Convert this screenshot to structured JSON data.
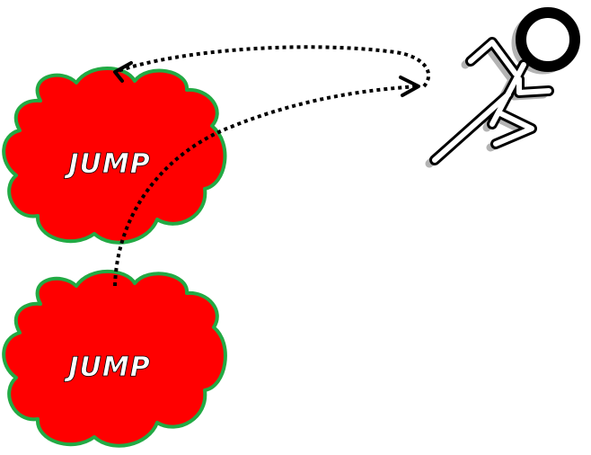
{
  "clouds": [
    {
      "id": "top",
      "label": "JUMP"
    },
    {
      "id": "bottom",
      "label": "JUMP"
    }
  ],
  "colors": {
    "cloud_fill": "#ff0000",
    "cloud_outline": "#22aa44",
    "label_fill": "#ffffff",
    "label_stroke": "#000000",
    "arrow": "#000000",
    "runner_stroke": "#000000",
    "runner_shadow": "#b3b3b3",
    "background": "#ffffff"
  },
  "icons": {
    "runner": "running-person-icon",
    "arrow_head": "chevron-arrowhead"
  }
}
